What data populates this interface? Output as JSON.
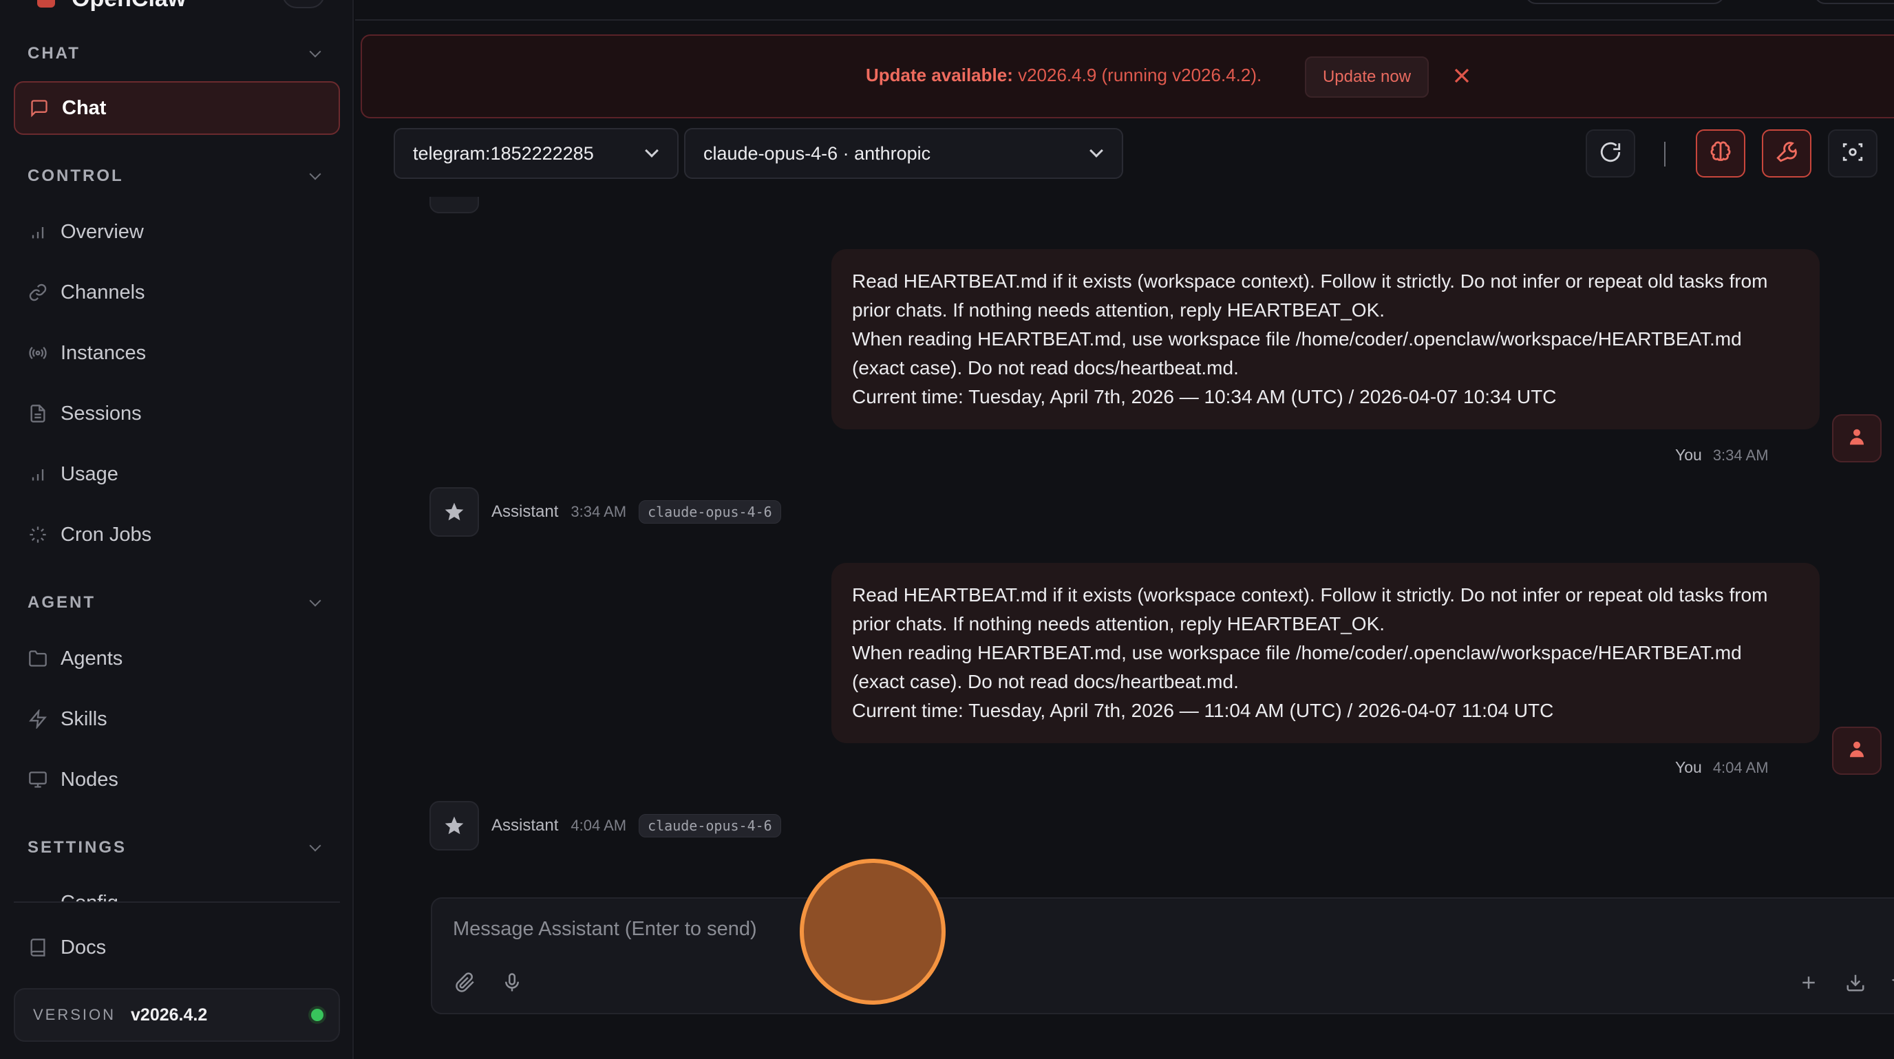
{
  "app": {
    "name": "OpenClaw"
  },
  "sidebar": {
    "sections": {
      "chat": "CHAT",
      "control": "CONTROL",
      "agent": "AGENT",
      "settings": "SETTINGS"
    },
    "items": {
      "chat": "Chat",
      "overview": "Overview",
      "channels": "Channels",
      "instances": "Instances",
      "sessions": "Sessions",
      "usage": "Usage",
      "cron_jobs": "Cron Jobs",
      "agents": "Agents",
      "skills": "Skills",
      "nodes": "Nodes",
      "config": "Config",
      "docs": "Docs"
    },
    "version": {
      "label": "VERSION",
      "value": "v2026.4.2",
      "status_color": "#38c45c"
    }
  },
  "banner": {
    "prefix": "Update available:",
    "text": " v2026.4.9 (running v2026.4.2).",
    "button": "Update now"
  },
  "toolbar": {
    "session_select": "telegram:1852222285",
    "model_select": "claude-opus-4-6 · anthropic"
  },
  "chat": {
    "messages": [
      {
        "role": "user",
        "lines": [
          "Read HEARTBEAT.md if it exists (workspace context). Follow it strictly. Do not infer or repeat old tasks from prior chats. If nothing needs attention, reply HEARTBEAT_OK.",
          "When reading HEARTBEAT.md, use workspace file /home/coder/.openclaw/workspace/HEARTBEAT.md (exact case). Do not read docs/heartbeat.md.",
          "Current time: Tuesday, April 7th, 2026 — 10:34 AM (UTC) / 2026-04-07 10:34 UTC"
        ],
        "who": "You",
        "time": "3:34 AM"
      },
      {
        "role": "assistant",
        "who": "Assistant",
        "time": "3:34 AM",
        "model": "claude-opus-4-6"
      },
      {
        "role": "user",
        "lines": [
          "Read HEARTBEAT.md if it exists (workspace context). Follow it strictly. Do not infer or repeat old tasks from prior chats. If nothing needs attention, reply HEARTBEAT_OK.",
          "When reading HEARTBEAT.md, use workspace file /home/coder/.openclaw/workspace/HEARTBEAT.md (exact case). Do not read docs/heartbeat.md.",
          "Current time: Tuesday, April 7th, 2026 — 11:04 AM (UTC) / 2026-04-07 11:04 UTC"
        ],
        "who": "You",
        "time": "4:04 AM"
      },
      {
        "role": "assistant",
        "who": "Assistant",
        "time": "4:04 AM",
        "model": "claude-opus-4-6"
      }
    ]
  },
  "composer": {
    "placeholder": "Message Assistant (Enter to send)"
  },
  "colors": {
    "accent": "#ef6b5e",
    "cursor": "#f59440"
  }
}
